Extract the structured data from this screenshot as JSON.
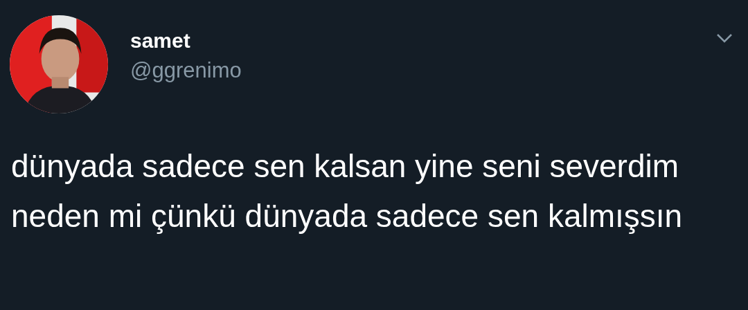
{
  "tweet": {
    "author": {
      "name": "samet",
      "handle": "@ggrenimo"
    },
    "text": "dünyada sadece sen kalsan yine seni severdim neden mi çünkü dünyada sadece sen kalmışsın"
  }
}
